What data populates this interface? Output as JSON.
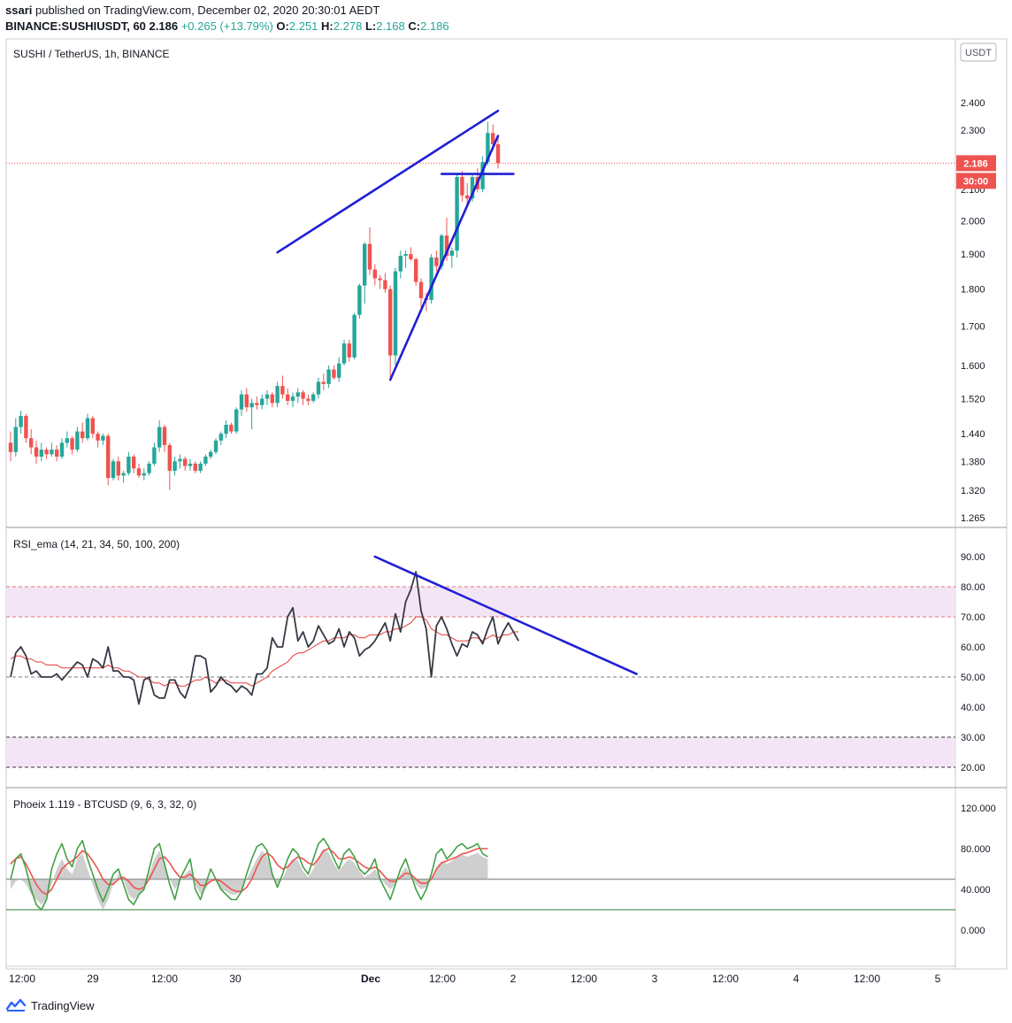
{
  "header": {
    "user": "ssari",
    "published": " published on TradingView.com, December 02, 2020 20:30:01 AEDT",
    "symbol": "BINANCE:SUSHIUSDT, 60",
    "last": "2.186",
    "change": "+0.265 (+13.79%)",
    "o_label": "O:",
    "o": "2.251",
    "h_label": "H:",
    "h": "2.278",
    "l_label": "L:",
    "l": "2.168",
    "c_label": "C:",
    "c": "2.186"
  },
  "footer": {
    "brand": "TradingView"
  },
  "colors": {
    "up": "#26a69a",
    "down": "#ef5350",
    "trendline": "#1f1fd6",
    "rsi": "#363a45",
    "rsi_ema": "#e53935",
    "band": "#f3e5f5",
    "phoeix_green": "#43a047",
    "phoeix_red": "#ef5350",
    "phoeix_area": "#cfcfcf"
  },
  "chart_data": [
    {
      "type": "candlestick",
      "title": "SUSHI / TetherUS, 1h, BINANCE",
      "currency_badge": "USDT",
      "y_axis": {
        "scale": "log",
        "ticks": [
          "2.400",
          "2.300",
          "2.100",
          "2.000",
          "1.900",
          "1.800",
          "1.700",
          "1.600",
          "1.520",
          "1.440",
          "1.380",
          "1.320",
          "1.265"
        ]
      },
      "last_price": "2.186",
      "countdown": "30:00",
      "x_axis": {
        "ticks": [
          "12:00",
          "29",
          "12:00",
          "30",
          "Dec",
          "12:00",
          "2",
          "12:00",
          "3",
          "12:00",
          "4",
          "12:00",
          "5"
        ]
      },
      "ohlc": [
        [
          1.42,
          1.445,
          1.38,
          1.4
        ],
        [
          1.4,
          1.475,
          1.39,
          1.455
        ],
        [
          1.455,
          1.492,
          1.44,
          1.48
        ],
        [
          1.48,
          1.485,
          1.42,
          1.43
        ],
        [
          1.43,
          1.45,
          1.395,
          1.41
        ],
        [
          1.41,
          1.425,
          1.375,
          1.39
        ],
        [
          1.39,
          1.42,
          1.38,
          1.405
        ],
        [
          1.405,
          1.41,
          1.385,
          1.395
        ],
        [
          1.395,
          1.42,
          1.39,
          1.405
        ],
        [
          1.405,
          1.415,
          1.38,
          1.39
        ],
        [
          1.39,
          1.43,
          1.385,
          1.42
        ],
        [
          1.42,
          1.445,
          1.41,
          1.43
        ],
        [
          1.43,
          1.435,
          1.395,
          1.405
        ],
        [
          1.405,
          1.455,
          1.4,
          1.445
        ],
        [
          1.445,
          1.465,
          1.42,
          1.43
        ],
        [
          1.43,
          1.485,
          1.425,
          1.475
        ],
        [
          1.475,
          1.48,
          1.43,
          1.44
        ],
        [
          1.44,
          1.445,
          1.41,
          1.425
        ],
        [
          1.425,
          1.44,
          1.415,
          1.435
        ],
        [
          1.435,
          1.44,
          1.33,
          1.345
        ],
        [
          1.345,
          1.385,
          1.34,
          1.38
        ],
        [
          1.38,
          1.39,
          1.34,
          1.35
        ],
        [
          1.35,
          1.36,
          1.335,
          1.355
        ],
        [
          1.355,
          1.4,
          1.35,
          1.39
        ],
        [
          1.39,
          1.395,
          1.355,
          1.365
        ],
        [
          1.365,
          1.375,
          1.345,
          1.35
        ],
        [
          1.35,
          1.365,
          1.34,
          1.355
        ],
        [
          1.355,
          1.38,
          1.35,
          1.375
        ],
        [
          1.375,
          1.42,
          1.37,
          1.41
        ],
        [
          1.41,
          1.47,
          1.4,
          1.455
        ],
        [
          1.455,
          1.46,
          1.4,
          1.415
        ],
        [
          1.415,
          1.42,
          1.32,
          1.36
        ],
        [
          1.36,
          1.39,
          1.35,
          1.38
        ],
        [
          1.38,
          1.395,
          1.365,
          1.385
        ],
        [
          1.385,
          1.39,
          1.36,
          1.37
        ],
        [
          1.37,
          1.385,
          1.36,
          1.375
        ],
        [
          1.375,
          1.38,
          1.355,
          1.36
        ],
        [
          1.36,
          1.38,
          1.355,
          1.375
        ],
        [
          1.375,
          1.395,
          1.37,
          1.39
        ],
        [
          1.39,
          1.405,
          1.385,
          1.4
        ],
        [
          1.4,
          1.43,
          1.395,
          1.425
        ],
        [
          1.425,
          1.445,
          1.415,
          1.44
        ],
        [
          1.44,
          1.47,
          1.43,
          1.46
        ],
        [
          1.46,
          1.465,
          1.44,
          1.445
        ],
        [
          1.445,
          1.5,
          1.44,
          1.495
        ],
        [
          1.495,
          1.54,
          1.48,
          1.53
        ],
        [
          1.53,
          1.545,
          1.49,
          1.5
        ],
        [
          1.5,
          1.52,
          1.45,
          1.51
        ],
        [
          1.51,
          1.525,
          1.495,
          1.505
        ],
        [
          1.505,
          1.53,
          1.495,
          1.52
        ],
        [
          1.52,
          1.54,
          1.505,
          1.53
        ],
        [
          1.53,
          1.535,
          1.5,
          1.51
        ],
        [
          1.51,
          1.56,
          1.5,
          1.55
        ],
        [
          1.55,
          1.575,
          1.52,
          1.53
        ],
        [
          1.53,
          1.545,
          1.505,
          1.515
        ],
        [
          1.515,
          1.535,
          1.5,
          1.525
        ],
        [
          1.525,
          1.545,
          1.51,
          1.535
        ],
        [
          1.535,
          1.54,
          1.505,
          1.52
        ],
        [
          1.52,
          1.53,
          1.505,
          1.515
        ],
        [
          1.515,
          1.535,
          1.51,
          1.53
        ],
        [
          1.53,
          1.57,
          1.52,
          1.56
        ],
        [
          1.56,
          1.58,
          1.54,
          1.555
        ],
        [
          1.555,
          1.6,
          1.545,
          1.59
        ],
        [
          1.59,
          1.6,
          1.565,
          1.57
        ],
        [
          1.57,
          1.62,
          1.56,
          1.605
        ],
        [
          1.605,
          1.665,
          1.6,
          1.655
        ],
        [
          1.655,
          1.665,
          1.61,
          1.62
        ],
        [
          1.62,
          1.735,
          1.615,
          1.73
        ],
        [
          1.73,
          1.815,
          1.72,
          1.81
        ],
        [
          1.81,
          1.935,
          1.76,
          1.93
        ],
        [
          1.93,
          1.98,
          1.84,
          1.855
        ],
        [
          1.855,
          1.87,
          1.81,
          1.83
        ],
        [
          1.83,
          1.84,
          1.8,
          1.825
        ],
        [
          1.825,
          1.845,
          1.79,
          1.8
        ],
        [
          1.8,
          1.81,
          1.57,
          1.625
        ],
        [
          1.625,
          1.86,
          1.6,
          1.85
        ],
        [
          1.85,
          1.91,
          1.83,
          1.895
        ],
        [
          1.895,
          1.91,
          1.86,
          1.9
        ],
        [
          1.9,
          1.92,
          1.88,
          1.885
        ],
        [
          1.885,
          1.89,
          1.81,
          1.82
        ],
        [
          1.82,
          1.83,
          1.75,
          1.775
        ],
        [
          1.775,
          1.79,
          1.74,
          1.77
        ],
        [
          1.77,
          1.9,
          1.76,
          1.89
        ],
        [
          1.89,
          1.91,
          1.85,
          1.865
        ],
        [
          1.865,
          1.96,
          1.855,
          1.955
        ],
        [
          1.955,
          2.01,
          1.88,
          1.895
        ],
        [
          1.895,
          1.92,
          1.86,
          1.91
        ],
        [
          1.91,
          2.15,
          1.89,
          2.14
        ],
        [
          2.14,
          2.16,
          2.06,
          2.08
        ],
        [
          2.08,
          2.12,
          2.05,
          2.07
        ],
        [
          2.07,
          2.15,
          2.06,
          2.14
        ],
        [
          2.14,
          2.17,
          2.09,
          2.1
        ],
        [
          2.1,
          2.21,
          2.09,
          2.19
        ],
        [
          2.19,
          2.33,
          2.18,
          2.29
        ],
        [
          2.29,
          2.32,
          2.23,
          2.251
        ],
        [
          2.251,
          2.278,
          2.168,
          2.186
        ]
      ],
      "annotations": {
        "wedge_upper": [
          [
            52,
            1.905
          ],
          [
            95,
            2.37
          ]
        ],
        "wedge_lower": [
          [
            74,
            1.565
          ],
          [
            95,
            2.28
          ]
        ],
        "horizontal": [
          [
            84,
            2.15
          ],
          [
            98,
            2.15
          ]
        ]
      }
    },
    {
      "type": "line",
      "title": "RSI_ema (14, 21, 34, 50, 100, 200)",
      "y_axis": {
        "ticks": [
          "90.00",
          "80.00",
          "70.00",
          "60.00",
          "50.00",
          "40.00",
          "30.00",
          "20.00"
        ]
      },
      "levels": [
        80,
        70,
        50,
        30,
        20
      ],
      "series": [
        {
          "values": [
            50,
            58,
            60,
            57,
            51,
            52,
            50,
            50,
            50,
            51,
            49,
            51,
            53,
            55,
            54,
            50,
            56,
            55,
            53,
            60,
            52,
            52,
            50,
            50,
            49,
            41,
            49,
            50,
            44,
            43,
            43,
            49,
            49,
            45,
            43,
            48,
            57,
            57,
            56,
            45,
            47,
            50,
            48,
            47,
            45,
            47,
            46,
            44,
            51,
            51,
            53,
            63,
            60,
            60,
            70,
            73,
            62,
            65,
            60,
            62,
            67,
            64,
            61,
            62,
            66,
            60,
            65,
            63,
            57,
            59,
            60,
            62,
            65,
            68,
            62,
            71,
            65,
            75,
            79,
            85,
            72,
            66,
            50,
            67,
            70,
            66,
            61,
            57,
            61,
            60,
            65,
            64,
            61,
            66,
            70,
            61,
            65,
            68,
            65,
            62
          ]
        },
        {
          "values": [
            56,
            57,
            57,
            56,
            56,
            55,
            55,
            54,
            54,
            54,
            53,
            53,
            53,
            53,
            53,
            53,
            53,
            53,
            53,
            54,
            53,
            53,
            52,
            52,
            51,
            50,
            50,
            49,
            48,
            48,
            47,
            48,
            48,
            47,
            47,
            48,
            49,
            49,
            50,
            49,
            48,
            49,
            49,
            48,
            48,
            48,
            48,
            47,
            48,
            49,
            50,
            52,
            53,
            54,
            55,
            57,
            58,
            58,
            59,
            60,
            61,
            62,
            62,
            63,
            63,
            63,
            64,
            64,
            63,
            63,
            64,
            64,
            64,
            65,
            65,
            66,
            66,
            67,
            68,
            70,
            70,
            69,
            66,
            65,
            64,
            64,
            63,
            62,
            62,
            62,
            63,
            63,
            62,
            63,
            64,
            63,
            64,
            64,
            65,
            65
          ]
        }
      ],
      "annotations": {
        "trendline": [
          [
            71,
            90
          ],
          [
            122,
            51
          ]
        ]
      }
    },
    {
      "type": "line",
      "title": "Phoeix 1.119 - BTCUSD (9, 6, 3, 32, 0)",
      "y_axis": {
        "ticks": [
          "120.000",
          "80.000",
          "40.000",
          "0.000"
        ]
      },
      "levels": [
        50,
        20
      ],
      "series": [
        {
          "values": [
            50,
            70,
            75,
            60,
            40,
            25,
            20,
            30,
            60,
            75,
            85,
            70,
            62,
            80,
            88,
            70,
            55,
            40,
            28,
            40,
            55,
            60,
            45,
            30,
            25,
            35,
            40,
            60,
            80,
            85,
            65,
            45,
            30,
            50,
            60,
            70,
            40,
            30,
            45,
            60,
            50,
            40,
            35,
            30,
            30,
            38,
            55,
            70,
            82,
            85,
            78,
            55,
            42,
            55,
            70,
            80,
            75,
            62,
            55,
            70,
            85,
            90,
            82,
            70,
            60,
            75,
            80,
            72,
            60,
            55,
            60,
            70,
            50,
            40,
            30,
            45,
            60,
            70,
            55,
            40,
            30,
            40,
            55,
            75,
            80,
            70,
            75,
            82,
            85,
            80,
            82,
            85,
            75,
            72
          ]
        },
        {
          "values": [
            65,
            70,
            72,
            65,
            55,
            45,
            38,
            35,
            40,
            50,
            60,
            65,
            68,
            72,
            78,
            75,
            68,
            60,
            50,
            45,
            45,
            50,
            52,
            48,
            42,
            40,
            42,
            50,
            60,
            70,
            72,
            66,
            58,
            52,
            52,
            55,
            50,
            44,
            44,
            48,
            50,
            48,
            44,
            40,
            38,
            38,
            42,
            50,
            62,
            72,
            76,
            72,
            64,
            60,
            62,
            68,
            72,
            70,
            66,
            64,
            70,
            78,
            80,
            76,
            70,
            70,
            72,
            70,
            66,
            62,
            60,
            62,
            58,
            52,
            48,
            48,
            52,
            56,
            55,
            50,
            46,
            46,
            50,
            60,
            66,
            68,
            70,
            72,
            75,
            76,
            78,
            80,
            80,
            80
          ]
        },
        {
          "values": [
            40,
            48,
            50,
            45,
            35,
            30,
            25,
            30,
            45,
            60,
            70,
            60,
            55,
            70,
            75,
            60,
            45,
            30,
            20,
            30,
            45,
            55,
            50,
            35,
            30,
            35,
            40,
            55,
            70,
            78,
            65,
            50,
            40,
            48,
            55,
            60,
            45,
            35,
            40,
            50,
            48,
            40,
            38,
            35,
            35,
            38,
            50,
            60,
            70,
            78,
            72,
            55,
            45,
            50,
            62,
            70,
            68,
            58,
            52,
            60,
            72,
            80,
            76,
            65,
            58,
            65,
            70,
            66,
            58,
            52,
            55,
            60,
            52,
            45,
            40,
            45,
            55,
            62,
            55,
            45,
            40,
            42,
            50,
            62,
            68,
            65,
            68,
            72,
            74,
            72,
            74,
            76,
            72,
            70
          ]
        }
      ]
    }
  ]
}
